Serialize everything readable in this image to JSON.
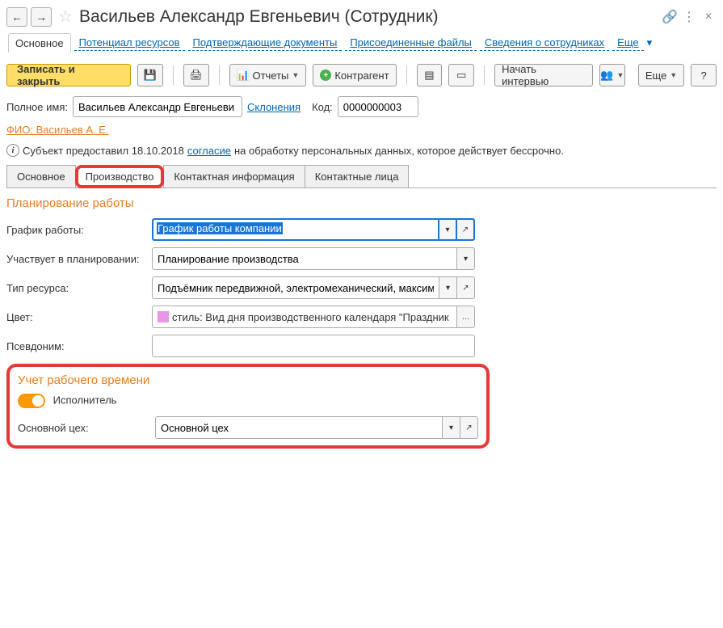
{
  "header": {
    "title": "Васильев Александр Евгеньевич (Сотрудник)"
  },
  "nav_links": {
    "main": "Основное",
    "potential": "Потенциал ресурсов",
    "docs": "Подтверждающие документы",
    "files": "Присоединенные файлы",
    "employees": "Сведения о сотрудниках",
    "more": "Еще"
  },
  "toolbar": {
    "save_close": "Записать и закрыть",
    "reports": "Отчеты",
    "contractor": "Контрагент",
    "interview": "Начать интервью",
    "more": "Еще"
  },
  "fields": {
    "full_name_label": "Полное имя:",
    "full_name_value": "Васильев Александр Евгеньеви",
    "declension": "Склонения",
    "code_label": "Код:",
    "code_value": "0000000003"
  },
  "fio_link": "ФИО: Васильев А. Е.",
  "consent": {
    "prefix": "Субъект предоставил 18.10.2018 ",
    "link": "согласие",
    "suffix": " на обработку персональных данных, которое действует бессрочно."
  },
  "tabs": {
    "main": "Основное",
    "production": "Производство",
    "contact": "Контактная информация",
    "persons": "Контактные лица"
  },
  "section1_title": "Планирование работы",
  "schedule": {
    "label": "График работы:",
    "value": "График работы компании"
  },
  "planning": {
    "label": "Участвует в планировании:",
    "value": "Планирование производства"
  },
  "resource_type": {
    "label": "Тип ресурса:",
    "value": "Подъёмник передвижной, электромеханический, максимал"
  },
  "color": {
    "label": "Цвет:",
    "value": "стиль: Вид дня производственного календаря \"Праздник"
  },
  "alias": {
    "label": "Псевдоним:",
    "value": ""
  },
  "section2_title": "Учет рабочего времени",
  "performer_label": "Исполнитель",
  "workshop": {
    "label": "Основной цех:",
    "value": "Основной цех"
  }
}
